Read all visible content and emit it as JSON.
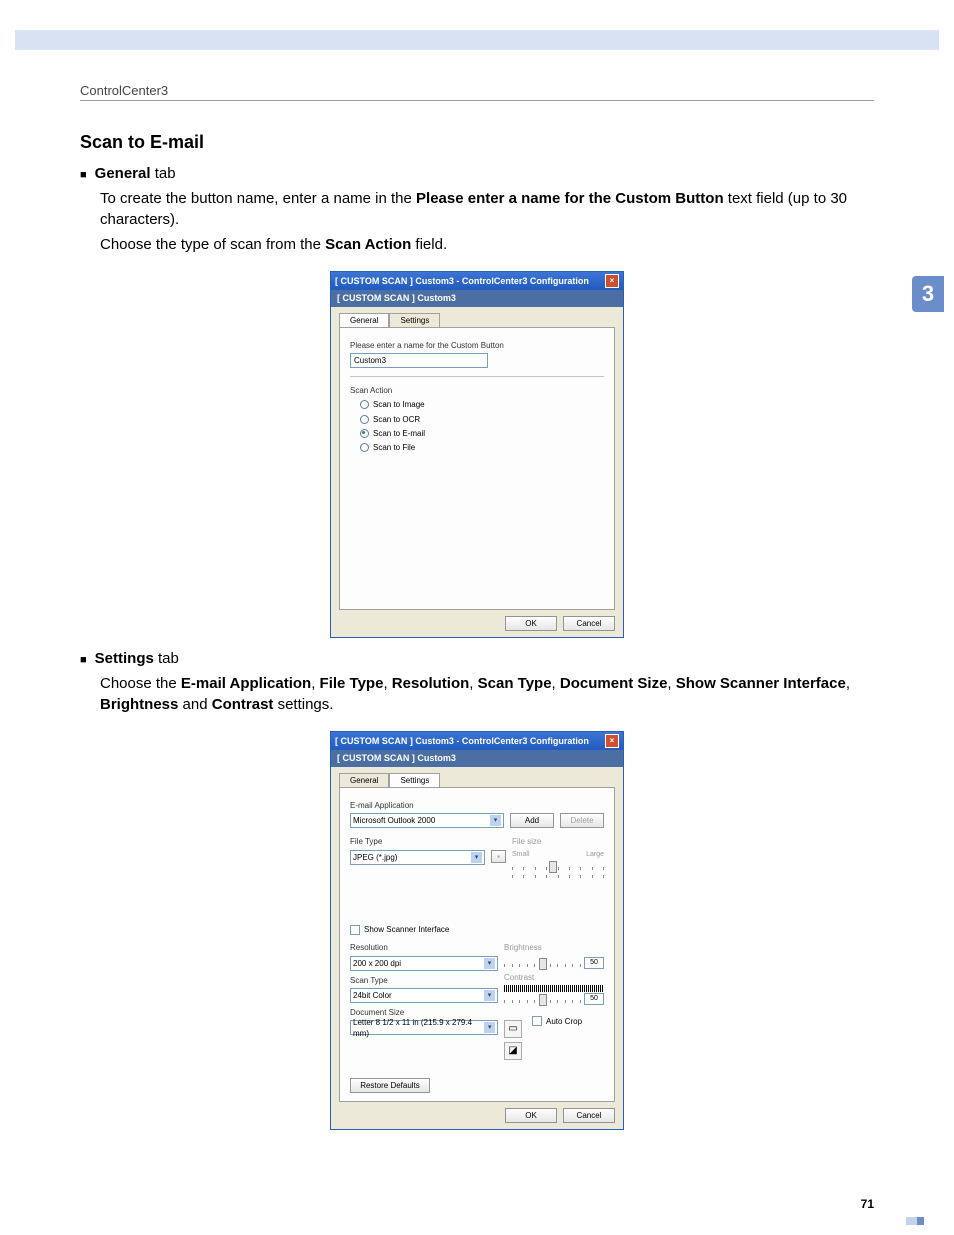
{
  "header": "ControlCenter3",
  "side_tab": "3",
  "page_number": "71",
  "section_title": "Scan to E-mail",
  "bullets": {
    "general": "General",
    "settings": "Settings",
    "tab_word": " tab"
  },
  "para1_pre": "To create the button name, enter a name in the ",
  "para1_bold": "Please enter a name for the Custom Button",
  "para1_post": " text field (up to 30 characters).",
  "para2_pre": "Choose the type of scan from the ",
  "para2_bold": "Scan Action",
  "para2_post": " field.",
  "para3_pre": "Choose the ",
  "para3_b1": "E-mail Application",
  "para3_s1": ", ",
  "para3_b2": "File Type",
  "para3_s2": ", ",
  "para3_b3": "Resolution",
  "para3_s3": ", ",
  "para3_b4": "Scan Type",
  "para3_s4": ", ",
  "para3_b5": "Document Size",
  "para3_s5": ", ",
  "para3_b6": "Show Scanner Interface",
  "para3_s6": ", ",
  "para3_b7": "Brightness",
  "para3_s7": " and ",
  "para3_b8": "Contrast",
  "para3_post": " settings.",
  "dlg": {
    "title": "[  CUSTOM SCAN  ]   Custom3 - ControlCenter3 Configuration",
    "subtitle": "[  CUSTOM SCAN  ]   Custom3",
    "tab_general": "General",
    "tab_settings": "Settings",
    "name_label": "Please enter a name for the Custom Button",
    "name_value": "Custom3",
    "scan_action_label": "Scan Action",
    "radios": {
      "image": "Scan to Image",
      "ocr": "Scan to OCR",
      "email": "Scan to E-mail",
      "file": "Scan to File"
    },
    "ok": "OK",
    "cancel": "Cancel"
  },
  "dlg2": {
    "email_app_label": "E-mail Application",
    "email_app_value": "Microsoft Outlook 2000",
    "add": "Add",
    "delete": "Delete",
    "file_type_label": "File Type",
    "file_type_value": "JPEG (*.jpg)",
    "file_size_label": "File size",
    "small": "Small",
    "large": "Large",
    "show_scanner": "Show Scanner Interface",
    "resolution_label": "Resolution",
    "resolution_value": "200 x 200 dpi",
    "scan_type_label": "Scan Type",
    "scan_type_value": "24bit Color",
    "doc_size_label": "Document Size",
    "doc_size_value": "Letter 8 1/2 x 11 in (215.9 x 279.4 mm)",
    "brightness_label": "Brightness",
    "contrast_label": "Contrast",
    "slider_value": "50",
    "auto_crop": "Auto Crop",
    "restore": "Restore Defaults"
  }
}
